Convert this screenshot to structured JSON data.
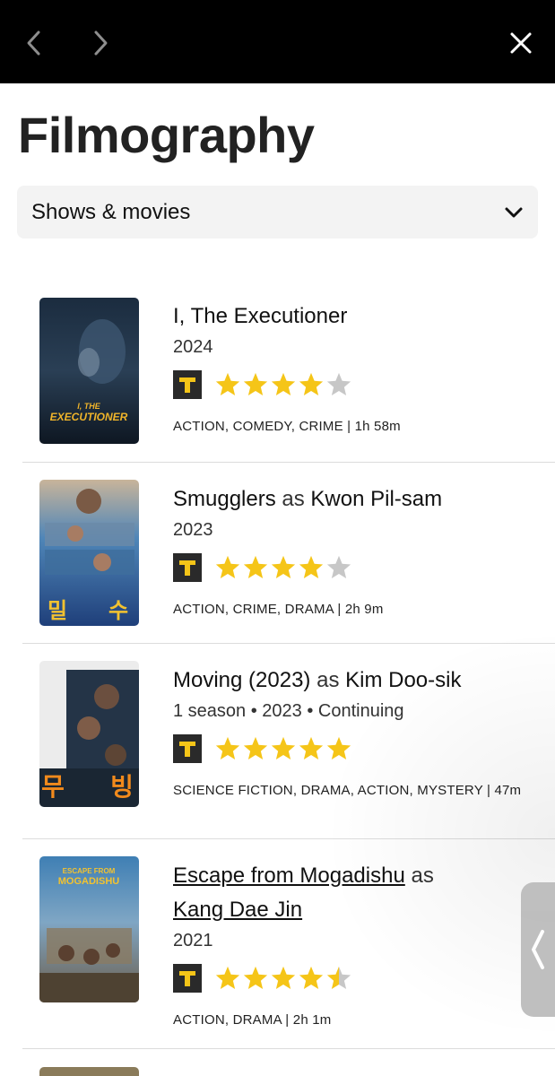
{
  "page": {
    "title": "Filmography",
    "filter": {
      "selected": "Shows & movies"
    }
  },
  "icons": {
    "back": "chevron-left-icon",
    "forward": "chevron-right-icon",
    "close": "close-icon",
    "dropdown": "chevron-down-icon",
    "tmdb": "t-badge-icon"
  },
  "colors": {
    "star": "#f5c518",
    "star_empty": "#c7c7c7",
    "badge": "#2a2a2a",
    "badge_letter": "#f5c518"
  },
  "items": [
    {
      "title": "I, The Executioner",
      "as": "",
      "role": "",
      "meta": "2024",
      "rating": 4,
      "genres": "ACTION, COMEDY, CRIME | 1h 58m",
      "linked": false
    },
    {
      "title": "Smugglers",
      "as": "as",
      "role": "Kwon Pil-sam",
      "meta": "2023",
      "rating": 4,
      "genres": "ACTION, CRIME, DRAMA | 2h 9m",
      "linked": false
    },
    {
      "title": "Moving (2023)",
      "as": "as",
      "role": "Kim Doo-sik",
      "meta": "1 season • 2023 • Continuing",
      "rating": 5,
      "genres": "SCIENCE FICTION, DRAMA, ACTION, MYSTERY | 47m",
      "linked": false
    },
    {
      "title": "Escape from Mogadishu",
      "as": "as",
      "role": "Kang Dae Jin",
      "meta": "2021",
      "rating": 4.5,
      "genres": "ACTION, DRAMA | 2h 1m",
      "linked": true
    }
  ],
  "posters": [
    {
      "text_line1": "I, THE",
      "text_line2": "EXECUTIONER"
    },
    {
      "text_left": "밀",
      "text_right": "수"
    },
    {
      "text_left": "무",
      "text_right": "빙"
    },
    {
      "text_line1": "ESCAPE FROM",
      "text_line2": "MOGADISHU"
    }
  ]
}
